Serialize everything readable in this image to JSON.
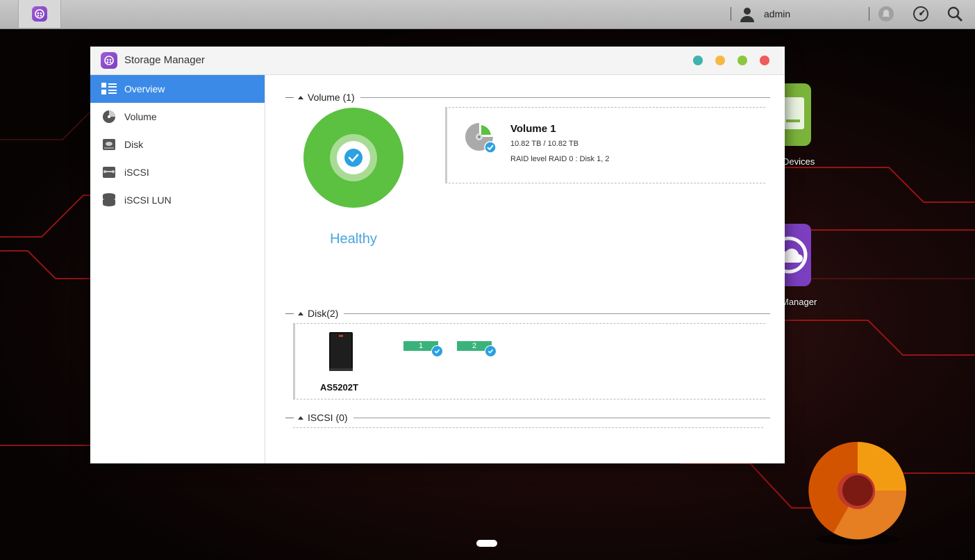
{
  "taskbar": {
    "username": "admin",
    "icons": [
      "storage-manager-icon",
      "user-icon",
      "notification-icon",
      "activity-monitor-icon",
      "search-icon"
    ]
  },
  "window": {
    "title": "Storage Manager",
    "controls": [
      "#3fb3b0",
      "#f5b942",
      "#8cc63f",
      "#f05a5a"
    ]
  },
  "sidebar": {
    "items": [
      {
        "label": "Overview",
        "icon": "overview-icon",
        "active": true
      },
      {
        "label": "Volume",
        "icon": "volume-icon",
        "active": false
      },
      {
        "label": "Disk",
        "icon": "disk-icon",
        "active": false
      },
      {
        "label": "iSCSI",
        "icon": "iscsi-icon",
        "active": false
      },
      {
        "label": "iSCSI LUN",
        "icon": "iscsi-lun-icon",
        "active": false
      }
    ]
  },
  "overview": {
    "volume_section": "Volume (1)",
    "health_status": "Healthy",
    "volume": {
      "name": "Volume 1",
      "capacity": "10.82 TB / 10.82 TB",
      "raid": "RAID level RAID 0 : Disk 1, 2"
    },
    "disk_section": "Disk(2)",
    "nas_model": "AS5202T",
    "disks": [
      {
        "label": "1"
      },
      {
        "label": "2"
      }
    ],
    "iscsi_section": "ISCSI (0)"
  },
  "desktop": {
    "icons": [
      {
        "label": "Devices",
        "color": "#7bb43a"
      },
      {
        "label": "Manager",
        "color": "#7b3fc0"
      }
    ]
  },
  "colors": {
    "accent": "#3b8ae8",
    "healthy": "#5cc041",
    "disk_slot": "#3ab37a",
    "check": "#2aa1e0"
  }
}
